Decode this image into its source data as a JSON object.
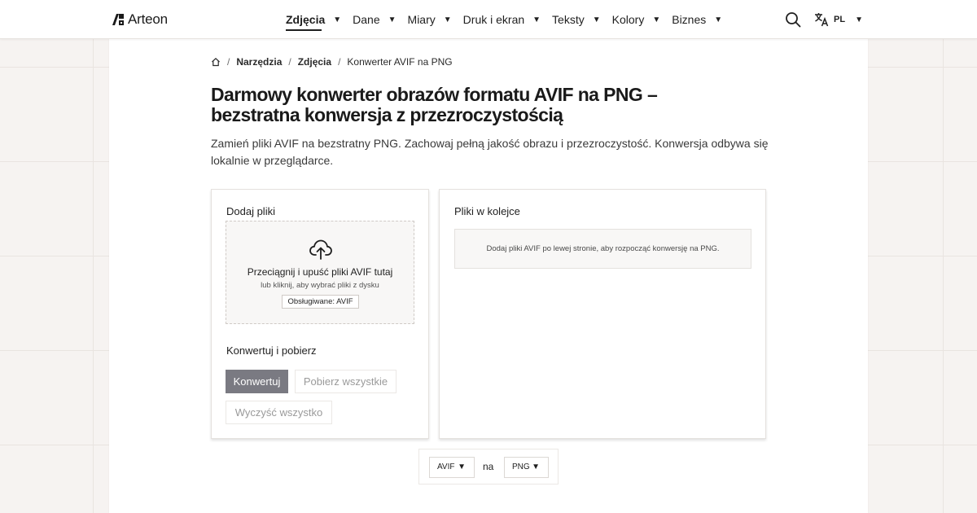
{
  "header": {
    "brand": "Arteon",
    "nav": [
      {
        "label": "Zdjęcia",
        "active": true
      },
      {
        "label": "Dane",
        "active": false
      },
      {
        "label": "Miary",
        "active": false
      },
      {
        "label": "Druk i ekran",
        "active": false
      },
      {
        "label": "Teksty",
        "active": false
      },
      {
        "label": "Kolory",
        "active": false
      },
      {
        "label": "Biznes",
        "active": false
      }
    ],
    "caret": "▼",
    "language": "PL",
    "icons": {
      "search": "search-icon",
      "language": "translate-icon"
    }
  },
  "breadcrumb": {
    "home_icon": "home-icon",
    "separator": "/",
    "items": [
      "Narzędzia",
      "Zdjęcia",
      "Konwerter AVIF na PNG"
    ]
  },
  "page": {
    "title": "Darmowy konwerter obrazów formatu AVIF na PNG – bezstratna konwersja z przezroczystością",
    "description": "Zamień pliki AVIF na bezstratny PNG. Zachowaj pełną jakość obrazu i przezroczystość. Konwersja odbywa się lokalnie w przeglądarce."
  },
  "upload_panel": {
    "heading": "Dodaj pliki",
    "dropzone_icon": "cloud-upload-icon",
    "dropzone_main": "Przeciągnij i upuść pliki AVIF tutaj",
    "dropzone_sub": "lub kliknij, aby wybrać pliki z dysku",
    "supported": "Obsługiwane: AVIF",
    "actions_heading": "Konwertuj i pobierz",
    "convert_label": "Konwertuj",
    "download_all_label": "Pobierz wszystkie",
    "clear_all_label": "Wyczyść wszystko"
  },
  "queue_panel": {
    "heading": "Pliki w kolejce",
    "empty_message": "Dodaj pliki AVIF po lewej stronie, aby rozpocząć konwersję na PNG."
  },
  "format_selector": {
    "from": "AVIF",
    "join": "na",
    "to": "PNG"
  },
  "colors": {
    "accent_button": "#7a7a82",
    "background": "#f6f3f1",
    "text": "#1f1f1f"
  }
}
